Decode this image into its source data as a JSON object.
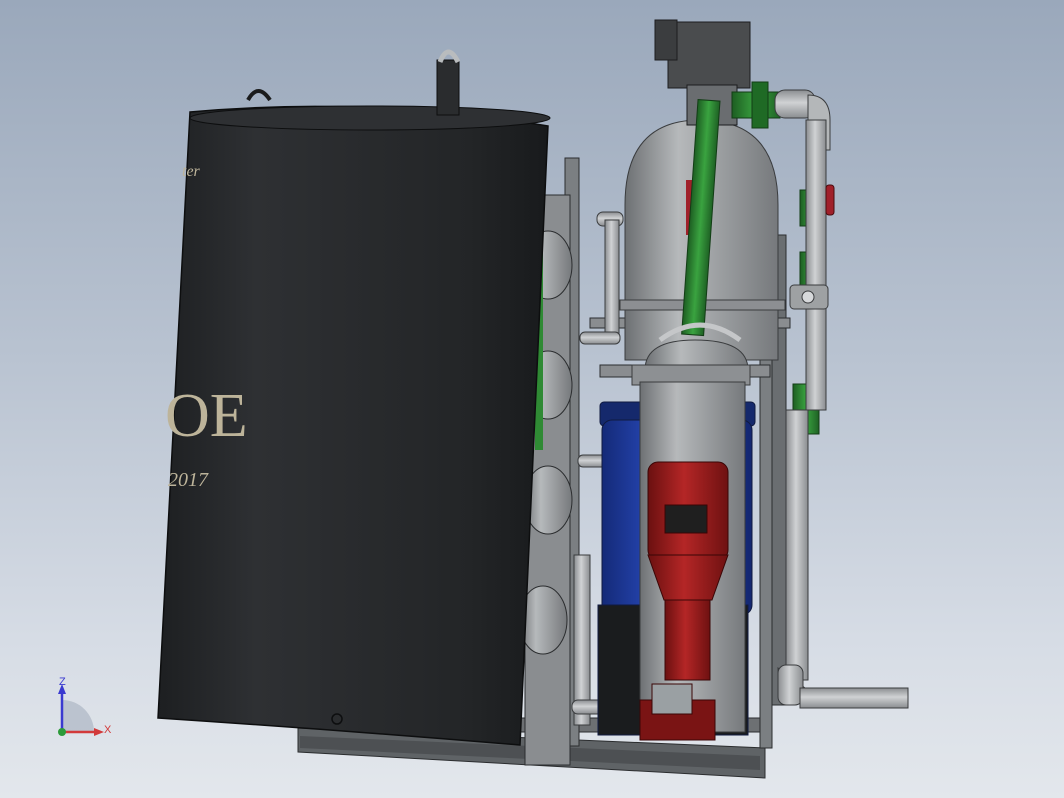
{
  "viewport": {
    "background_top": "#9aa8bb",
    "background_bottom": "#e3e7ec"
  },
  "model": {
    "tank_label_fragments": {
      "top_script": "ter",
      "large_letters": "OE",
      "date": "2017"
    },
    "colors": {
      "tank": "#2a2c2e",
      "frame": "#7b7f82",
      "pipe_gray": "#a9acae",
      "pipe_green": "#2f8a34",
      "vessel_blue": "#1f3ea0",
      "pump_red": "#9b1b1b",
      "valve_handle": "#a0202a"
    }
  },
  "triad": {
    "z_label": "Z",
    "x_label": "X",
    "z_color": "#3a3ad0",
    "x_color": "#d23a3a"
  }
}
